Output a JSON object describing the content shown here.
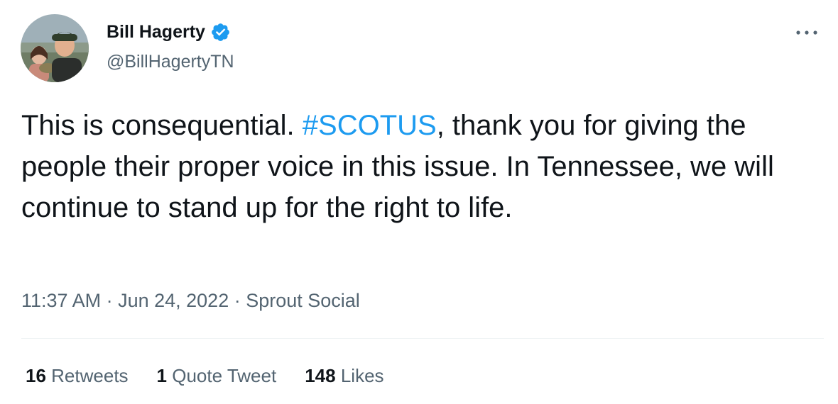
{
  "author": {
    "display_name": "Bill Hagerty",
    "handle": "@BillHagertyTN",
    "verified": true
  },
  "tweet": {
    "text_before": "This is consequential. ",
    "hashtag": "#SCOTUS",
    "text_after": ", thank you for giving the people their proper voice in this issue. In Tennessee, we will continue to stand up for the right to life."
  },
  "meta": {
    "time": "11:37 AM",
    "separator1": " · ",
    "date": "Jun 24, 2022",
    "separator2": " · ",
    "source": "Sprout Social"
  },
  "stats": {
    "retweets_count": "16",
    "retweets_label": "Retweets",
    "quotes_count": "1",
    "quotes_label": "Quote Tweet",
    "likes_count": "148",
    "likes_label": "Likes"
  },
  "icons": {
    "verified": "verified-badge-icon",
    "more": "more-horizontal-icon"
  },
  "colors": {
    "accent": "#1d9bf0",
    "text_primary": "#0f1419",
    "text_secondary": "#536471",
    "divider": "#eff3f4"
  }
}
